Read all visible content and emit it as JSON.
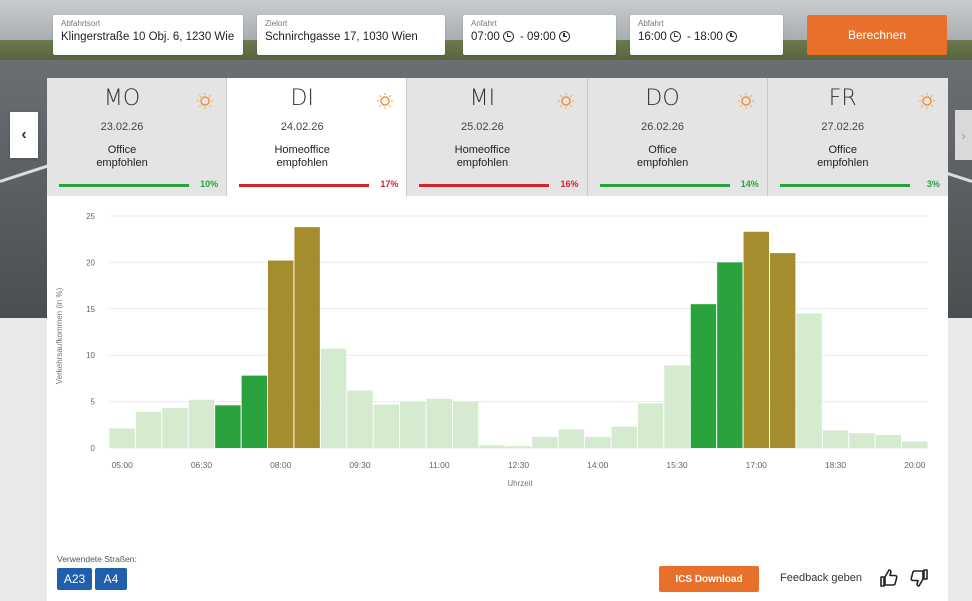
{
  "form": {
    "origin_label": "Abfahrtsort",
    "origin_value": "Klingerstraße 10 Obj. 6, 1230 Wien",
    "dest_label": "Zielort",
    "dest_value": "Schnirchgasse 17, 1030 Wien",
    "arrival_label": "Anfahrt",
    "arrival_from": "07:00",
    "arrival_sep": "-",
    "arrival_to": "09:00",
    "departure_label": "Abfahrt",
    "departure_from": "16:00",
    "departure_sep": "-",
    "departure_to": "18:00",
    "calculate_label": "Berechnen"
  },
  "nav": {
    "prev": "‹",
    "next": "›"
  },
  "days": [
    {
      "name": "MO",
      "date": "23.02.26",
      "rec1": "Office",
      "rec2": "empfohlen",
      "pct": "10%",
      "color": "#2aa33f"
    },
    {
      "name": "DI",
      "date": "24.02.26",
      "rec1": "Homeoffice",
      "rec2": "empfohlen",
      "pct": "17%",
      "color": "#d0252b"
    },
    {
      "name": "MI",
      "date": "25.02.26",
      "rec1": "Homeoffice",
      "rec2": "empfohlen",
      "pct": "16%",
      "color": "#d0252b"
    },
    {
      "name": "DO",
      "date": "26.02.26",
      "rec1": "Office",
      "rec2": "empfohlen",
      "pct": "14%",
      "color": "#2aa33f"
    },
    {
      "name": "FR",
      "date": "27.02.26",
      "rec1": "Office",
      "rec2": "empfohlen",
      "pct": "3%",
      "color": "#2aa33f"
    }
  ],
  "chart_data": {
    "type": "bar",
    "ylabel": "Verkehrsaufkommen (in %)",
    "xlabel": "Uhrzeit",
    "ylim": [
      0,
      25
    ],
    "yticks": [
      0,
      5,
      10,
      15,
      20,
      25
    ],
    "xtick_labels": [
      "05:00",
      "06:30",
      "08:00",
      "09:30",
      "11:00",
      "12:30",
      "14:00",
      "15:30",
      "17:00",
      "18:30",
      "20:00"
    ],
    "grid": true,
    "colors": {
      "off": "#d4ebcf",
      "low": "#2aa33f",
      "peak": "#a58c2c"
    },
    "values": [
      2.1,
      3.9,
      4.3,
      5.2,
      4.6,
      7.8,
      20.2,
      23.8,
      10.7,
      6.2,
      4.7,
      5.0,
      5.3,
      5.0,
      0.3,
      0.2,
      1.2,
      2.0,
      1.2,
      2.3,
      4.8,
      8.9,
      15.5,
      20.0,
      23.3,
      21.0,
      14.5,
      1.9,
      1.6,
      1.4,
      0.7
    ],
    "levels": [
      "off",
      "off",
      "off",
      "off",
      "low",
      "low",
      "peak",
      "peak",
      "off",
      "off",
      "off",
      "off",
      "off",
      "off",
      "off",
      "off",
      "off",
      "off",
      "off",
      "off",
      "off",
      "off",
      "low",
      "low",
      "peak",
      "peak",
      "off",
      "off",
      "off",
      "off",
      "off"
    ]
  },
  "footer": {
    "roads_label": "Verwendete Straßen:",
    "roads": [
      "A23",
      "A4"
    ],
    "ics_label": "ICS Download",
    "feedback_label": "Feedback geben"
  }
}
